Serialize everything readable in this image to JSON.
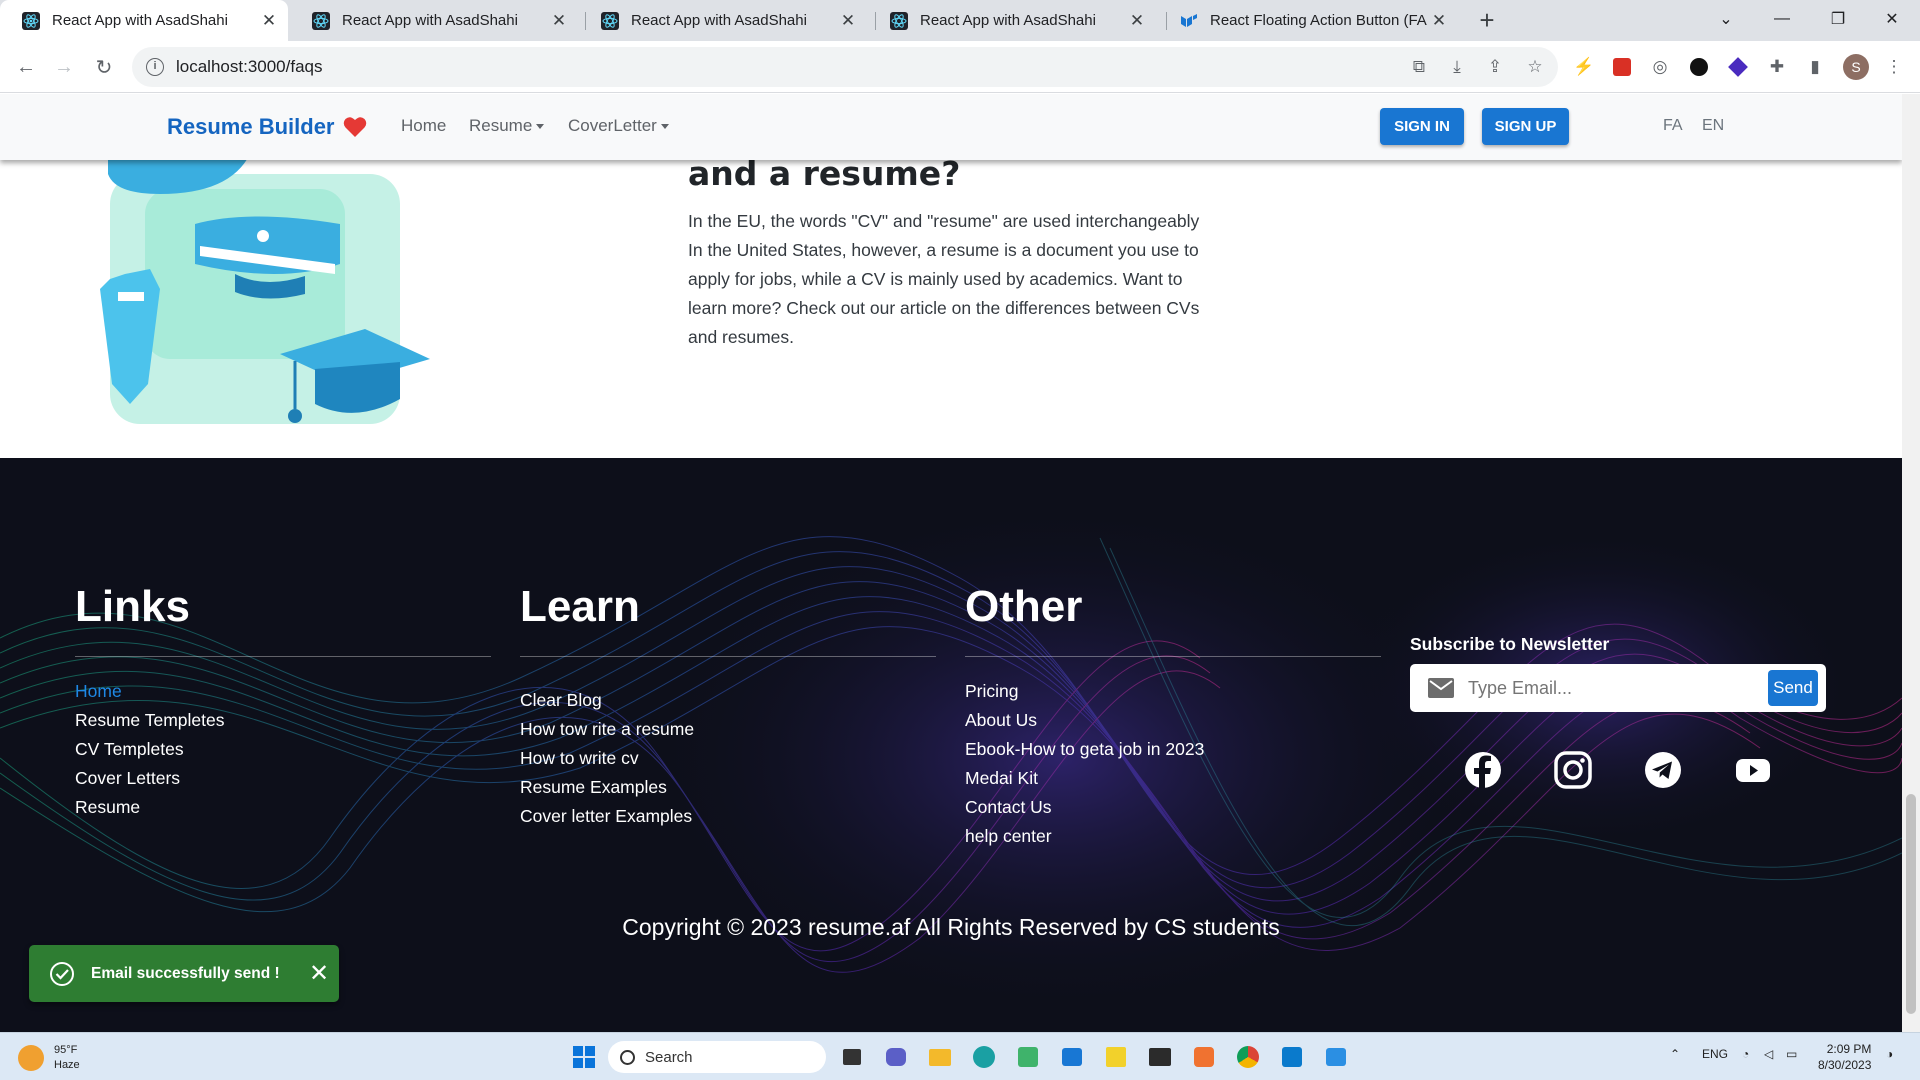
{
  "browser": {
    "tabs": [
      {
        "title": "React App with AsadShahi",
        "active": true
      },
      {
        "title": "React App with AsadShahi",
        "active": false
      },
      {
        "title": "React App with AsadShahi",
        "active": false
      },
      {
        "title": "React App with AsadShahi",
        "active": false
      },
      {
        "title": "React Floating Action Button (FA",
        "active": false
      }
    ],
    "url": "localhost:3000/faqs",
    "profile_initial": "S"
  },
  "site": {
    "brand": "Resume Builder",
    "nav": {
      "home": "Home",
      "resume": "Resume",
      "coverletter": "CoverLetter"
    },
    "sign_in": "SIGN IN",
    "sign_up": "SIGN UP",
    "lang_fa": "FA",
    "lang_en": "EN"
  },
  "faq": {
    "title_fragment": "and a resume?",
    "answer": "In the EU, the words \"CV\" and \"resume\" are used interchangeably In the United States, however, a resume is a document you use to apply for jobs, while a CV is mainly used by academics. Want to learn more? Check out our article on the differences between CVs and resumes."
  },
  "footer": {
    "links": {
      "title": "Links",
      "items": [
        "Home",
        "Resume Templetes",
        "CV Templetes",
        "Cover Letters",
        "Resume"
      ]
    },
    "learn": {
      "title": "Learn",
      "items": [
        "Clear Blog",
        "How tow rite a resume",
        "How to write cv",
        "Resume Examples",
        "Cover letter Examples"
      ]
    },
    "other": {
      "title": "Other",
      "items": [
        "Pricing",
        "About Us",
        "Ebook-How to geta job in 2023",
        "Medai Kit",
        "Contact Us",
        "help center"
      ]
    },
    "newsletter": {
      "title": "Subscribe to Newsletter",
      "placeholder": "Type Email...",
      "send": "Send"
    },
    "social": [
      "facebook-icon",
      "instagram-icon",
      "telegram-icon",
      "youtube-icon"
    ],
    "copyright": "Copyright © 2023 resume.af All Rights Reserved by CS students"
  },
  "toast": {
    "message": "Email successfully send !",
    "color": "#2e7d32"
  },
  "taskbar": {
    "weather_temp": "95°F",
    "weather_desc": "Haze",
    "search": "Search",
    "lang": "ENG",
    "time": "2:09 PM",
    "date": "8/30/2023"
  },
  "colors": {
    "brand": "#1565c0",
    "primary_button": "#1976d2",
    "footer_bg": "#0d0f1a",
    "active_link": "#1e88e5"
  }
}
